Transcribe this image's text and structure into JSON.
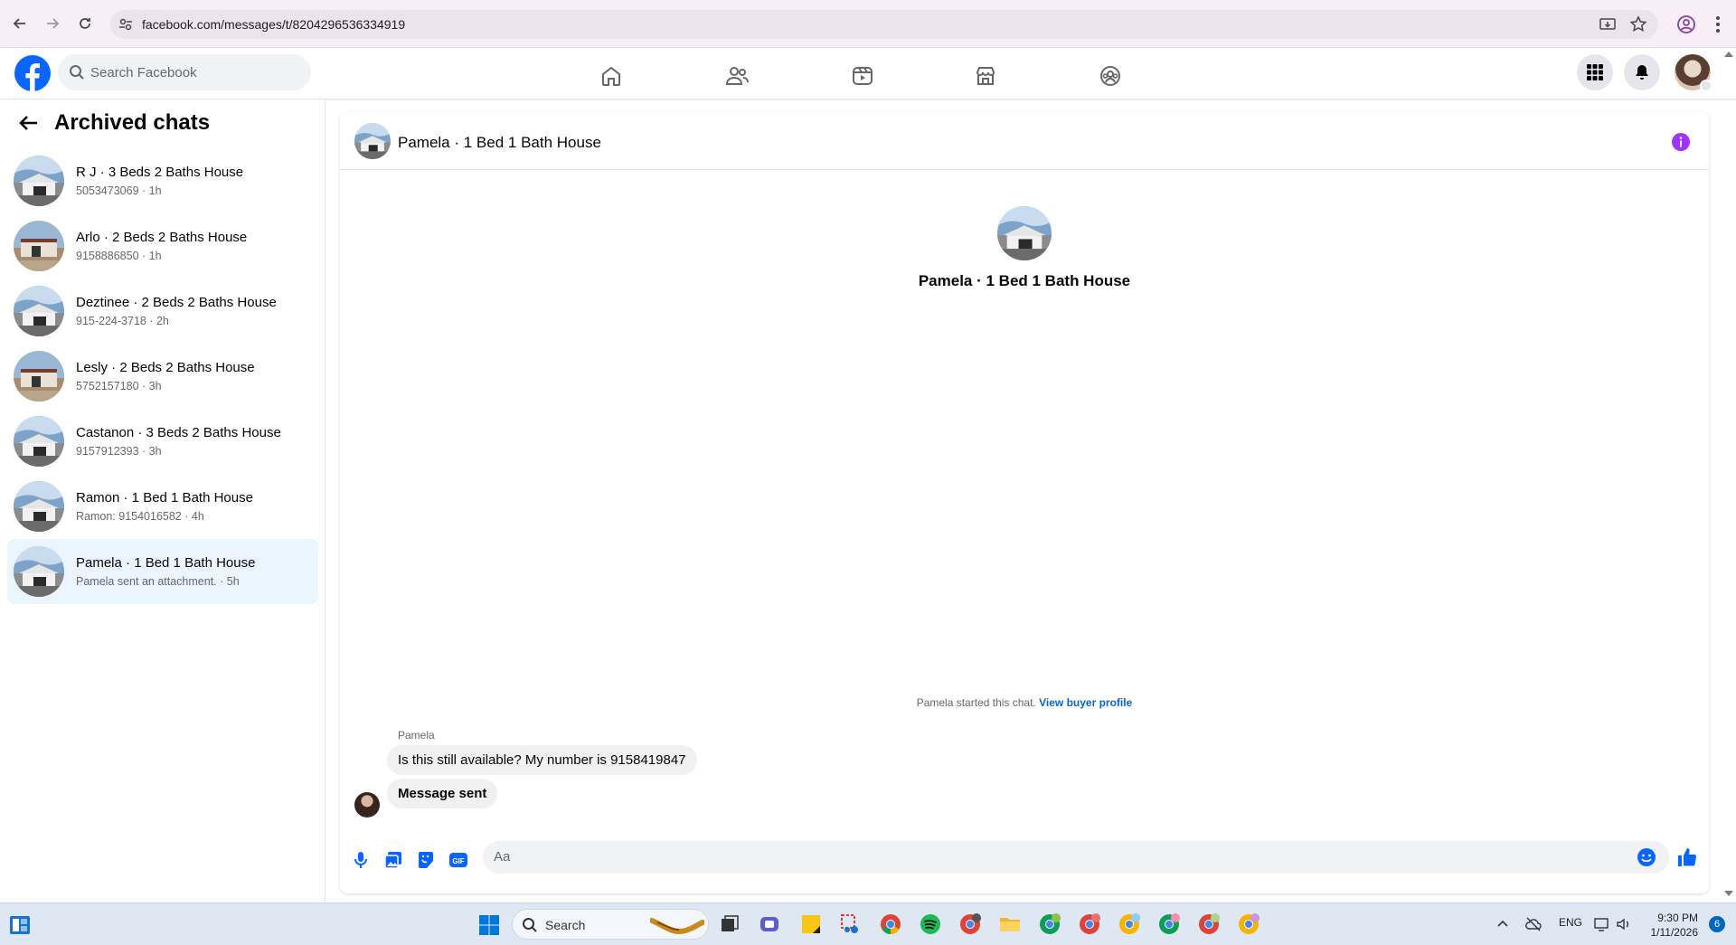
{
  "browser": {
    "url": "facebook.com/messages/t/8204296536334919"
  },
  "facebook": {
    "search_placeholder": "Search Facebook"
  },
  "sidebar": {
    "title": "Archived chats",
    "chats": [
      {
        "name": "R J · 3 Beds 2 Baths House",
        "sub": "5053473069 · 1h"
      },
      {
        "name": "Arlo · 2 Beds 2 Baths House",
        "sub": "9158886850 · 1h"
      },
      {
        "name": "Deztinee · 2 Beds 2 Baths House",
        "sub": "915-224-3718 · 2h"
      },
      {
        "name": "Lesly · 2 Beds 2 Baths House",
        "sub": "5752157180 · 3h"
      },
      {
        "name": "Castanon · 3 Beds 2 Baths House",
        "sub": "9157912393 · 3h"
      },
      {
        "name": "Ramon · 1 Bed 1 Bath House",
        "sub": "Ramon: 9154016582 · 4h"
      },
      {
        "name": "Pamela · 1 Bed 1 Bath House",
        "sub": "Pamela sent an attachment. · 5h"
      }
    ]
  },
  "conversation": {
    "title": "Pamela · 1 Bed 1 Bath House",
    "started_text": "Pamela started this chat.",
    "buyer_link": "View buyer profile",
    "sender": "Pamela",
    "messages": [
      {
        "text": "Is this still available? My number is 9158419847"
      },
      {
        "text": "Message sent"
      }
    ],
    "composer_placeholder": "Aa"
  },
  "taskbar": {
    "search_label": "Search",
    "language": "ENG",
    "time": "9:30 PM",
    "date": "1/11/2026",
    "notifications": "6"
  },
  "colors": {
    "facebook_blue": "#0866ff",
    "messenger_accent": "#a033ff",
    "active_chat_bg": "#ebf5ff"
  }
}
